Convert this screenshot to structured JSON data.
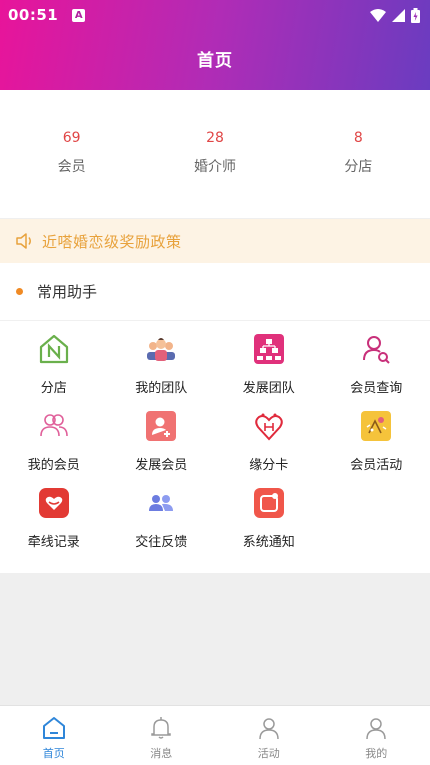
{
  "status_bar": {
    "time": "00:51",
    "badge": "A"
  },
  "header": {
    "title": "首页"
  },
  "stats": [
    {
      "value": "69",
      "label": "会员"
    },
    {
      "value": "28",
      "label": "婚介师"
    },
    {
      "value": "8",
      "label": "分店"
    }
  ],
  "notice": {
    "text": "近嗒婚恋级奖励政策"
  },
  "helper": {
    "title": "常用助手",
    "items": [
      {
        "label": "分店",
        "icon": "store-icon"
      },
      {
        "label": "我的团队",
        "icon": "team-icon"
      },
      {
        "label": "发展团队",
        "icon": "org-chart-icon"
      },
      {
        "label": "会员查询",
        "icon": "member-search-icon"
      },
      {
        "label": "我的会员",
        "icon": "members-icon"
      },
      {
        "label": "发展会员",
        "icon": "add-member-icon"
      },
      {
        "label": "缘分卡",
        "icon": "heart-card-icon"
      },
      {
        "label": "会员活动",
        "icon": "activity-icon"
      },
      {
        "label": "牵线记录",
        "icon": "match-record-icon"
      },
      {
        "label": "交往反馈",
        "icon": "feedback-icon"
      },
      {
        "label": "系统通知",
        "icon": "notification-icon"
      }
    ]
  },
  "tabs": [
    {
      "label": "首页",
      "icon": "home-icon",
      "active": true
    },
    {
      "label": "消息",
      "icon": "bell-icon",
      "active": false
    },
    {
      "label": "活动",
      "icon": "user-icon",
      "active": false
    },
    {
      "label": "我的",
      "icon": "user-icon",
      "active": false
    }
  ],
  "colors": {
    "header_gradient": [
      "#e8149a",
      "#6a3cc0"
    ],
    "stat_number": "#e04646",
    "notice_text": "#e8a23c",
    "active_tab": "#2f86d9"
  }
}
